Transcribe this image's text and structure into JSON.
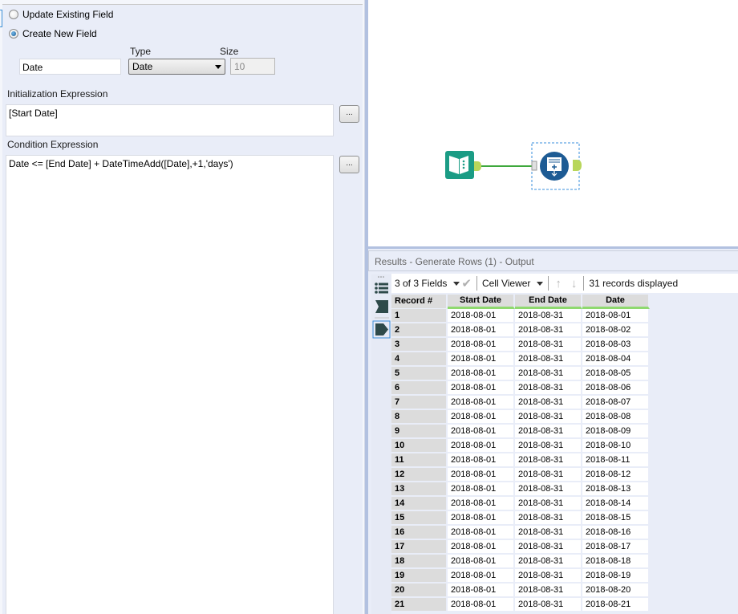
{
  "config": {
    "radio_update_label": "Update Existing Field",
    "radio_create_label": "Create New  Field",
    "selected_mode": "create",
    "field_name_value": "Date",
    "type_label": "Type",
    "type_value": "Date",
    "size_label": "Size",
    "size_value": "10",
    "init_expr_label": "Initialization Expression",
    "init_expr_value": "[Start Date]",
    "cond_expr_label": "Condition Expression",
    "cond_expr_value": "Date <= [End Date] + DateTimeAdd([Date],+1,'days')",
    "ellipsis_label": "..."
  },
  "canvas": {
    "tools": [
      {
        "name": "input-data-tool",
        "icon": "book-icon",
        "color": "#1b9c85"
      },
      {
        "name": "generate-rows-tool",
        "icon": "generate-rows-icon",
        "color": "#1d5b94"
      }
    ],
    "connection_color": "#3ea83c"
  },
  "results": {
    "title": "Results - Generate Rows (1) - Output",
    "fields_selector": "3 of 3 Fields",
    "cell_viewer": "Cell Viewer",
    "records_displayed": "31 records displayed",
    "columns": [
      "Record #",
      "Start Date",
      "End Date",
      "Date"
    ],
    "rows": [
      [
        "1",
        "2018-08-01",
        "2018-08-31",
        "2018-08-01"
      ],
      [
        "2",
        "2018-08-01",
        "2018-08-31",
        "2018-08-02"
      ],
      [
        "3",
        "2018-08-01",
        "2018-08-31",
        "2018-08-03"
      ],
      [
        "4",
        "2018-08-01",
        "2018-08-31",
        "2018-08-04"
      ],
      [
        "5",
        "2018-08-01",
        "2018-08-31",
        "2018-08-05"
      ],
      [
        "6",
        "2018-08-01",
        "2018-08-31",
        "2018-08-06"
      ],
      [
        "7",
        "2018-08-01",
        "2018-08-31",
        "2018-08-07"
      ],
      [
        "8",
        "2018-08-01",
        "2018-08-31",
        "2018-08-08"
      ],
      [
        "9",
        "2018-08-01",
        "2018-08-31",
        "2018-08-09"
      ],
      [
        "10",
        "2018-08-01",
        "2018-08-31",
        "2018-08-10"
      ],
      [
        "11",
        "2018-08-01",
        "2018-08-31",
        "2018-08-11"
      ],
      [
        "12",
        "2018-08-01",
        "2018-08-31",
        "2018-08-12"
      ],
      [
        "13",
        "2018-08-01",
        "2018-08-31",
        "2018-08-13"
      ],
      [
        "14",
        "2018-08-01",
        "2018-08-31",
        "2018-08-14"
      ],
      [
        "15",
        "2018-08-01",
        "2018-08-31",
        "2018-08-15"
      ],
      [
        "16",
        "2018-08-01",
        "2018-08-31",
        "2018-08-16"
      ],
      [
        "17",
        "2018-08-01",
        "2018-08-31",
        "2018-08-17"
      ],
      [
        "18",
        "2018-08-01",
        "2018-08-31",
        "2018-08-18"
      ],
      [
        "19",
        "2018-08-01",
        "2018-08-31",
        "2018-08-19"
      ],
      [
        "20",
        "2018-08-01",
        "2018-08-31",
        "2018-08-20"
      ],
      [
        "21",
        "2018-08-01",
        "2018-08-31",
        "2018-08-21"
      ]
    ]
  }
}
